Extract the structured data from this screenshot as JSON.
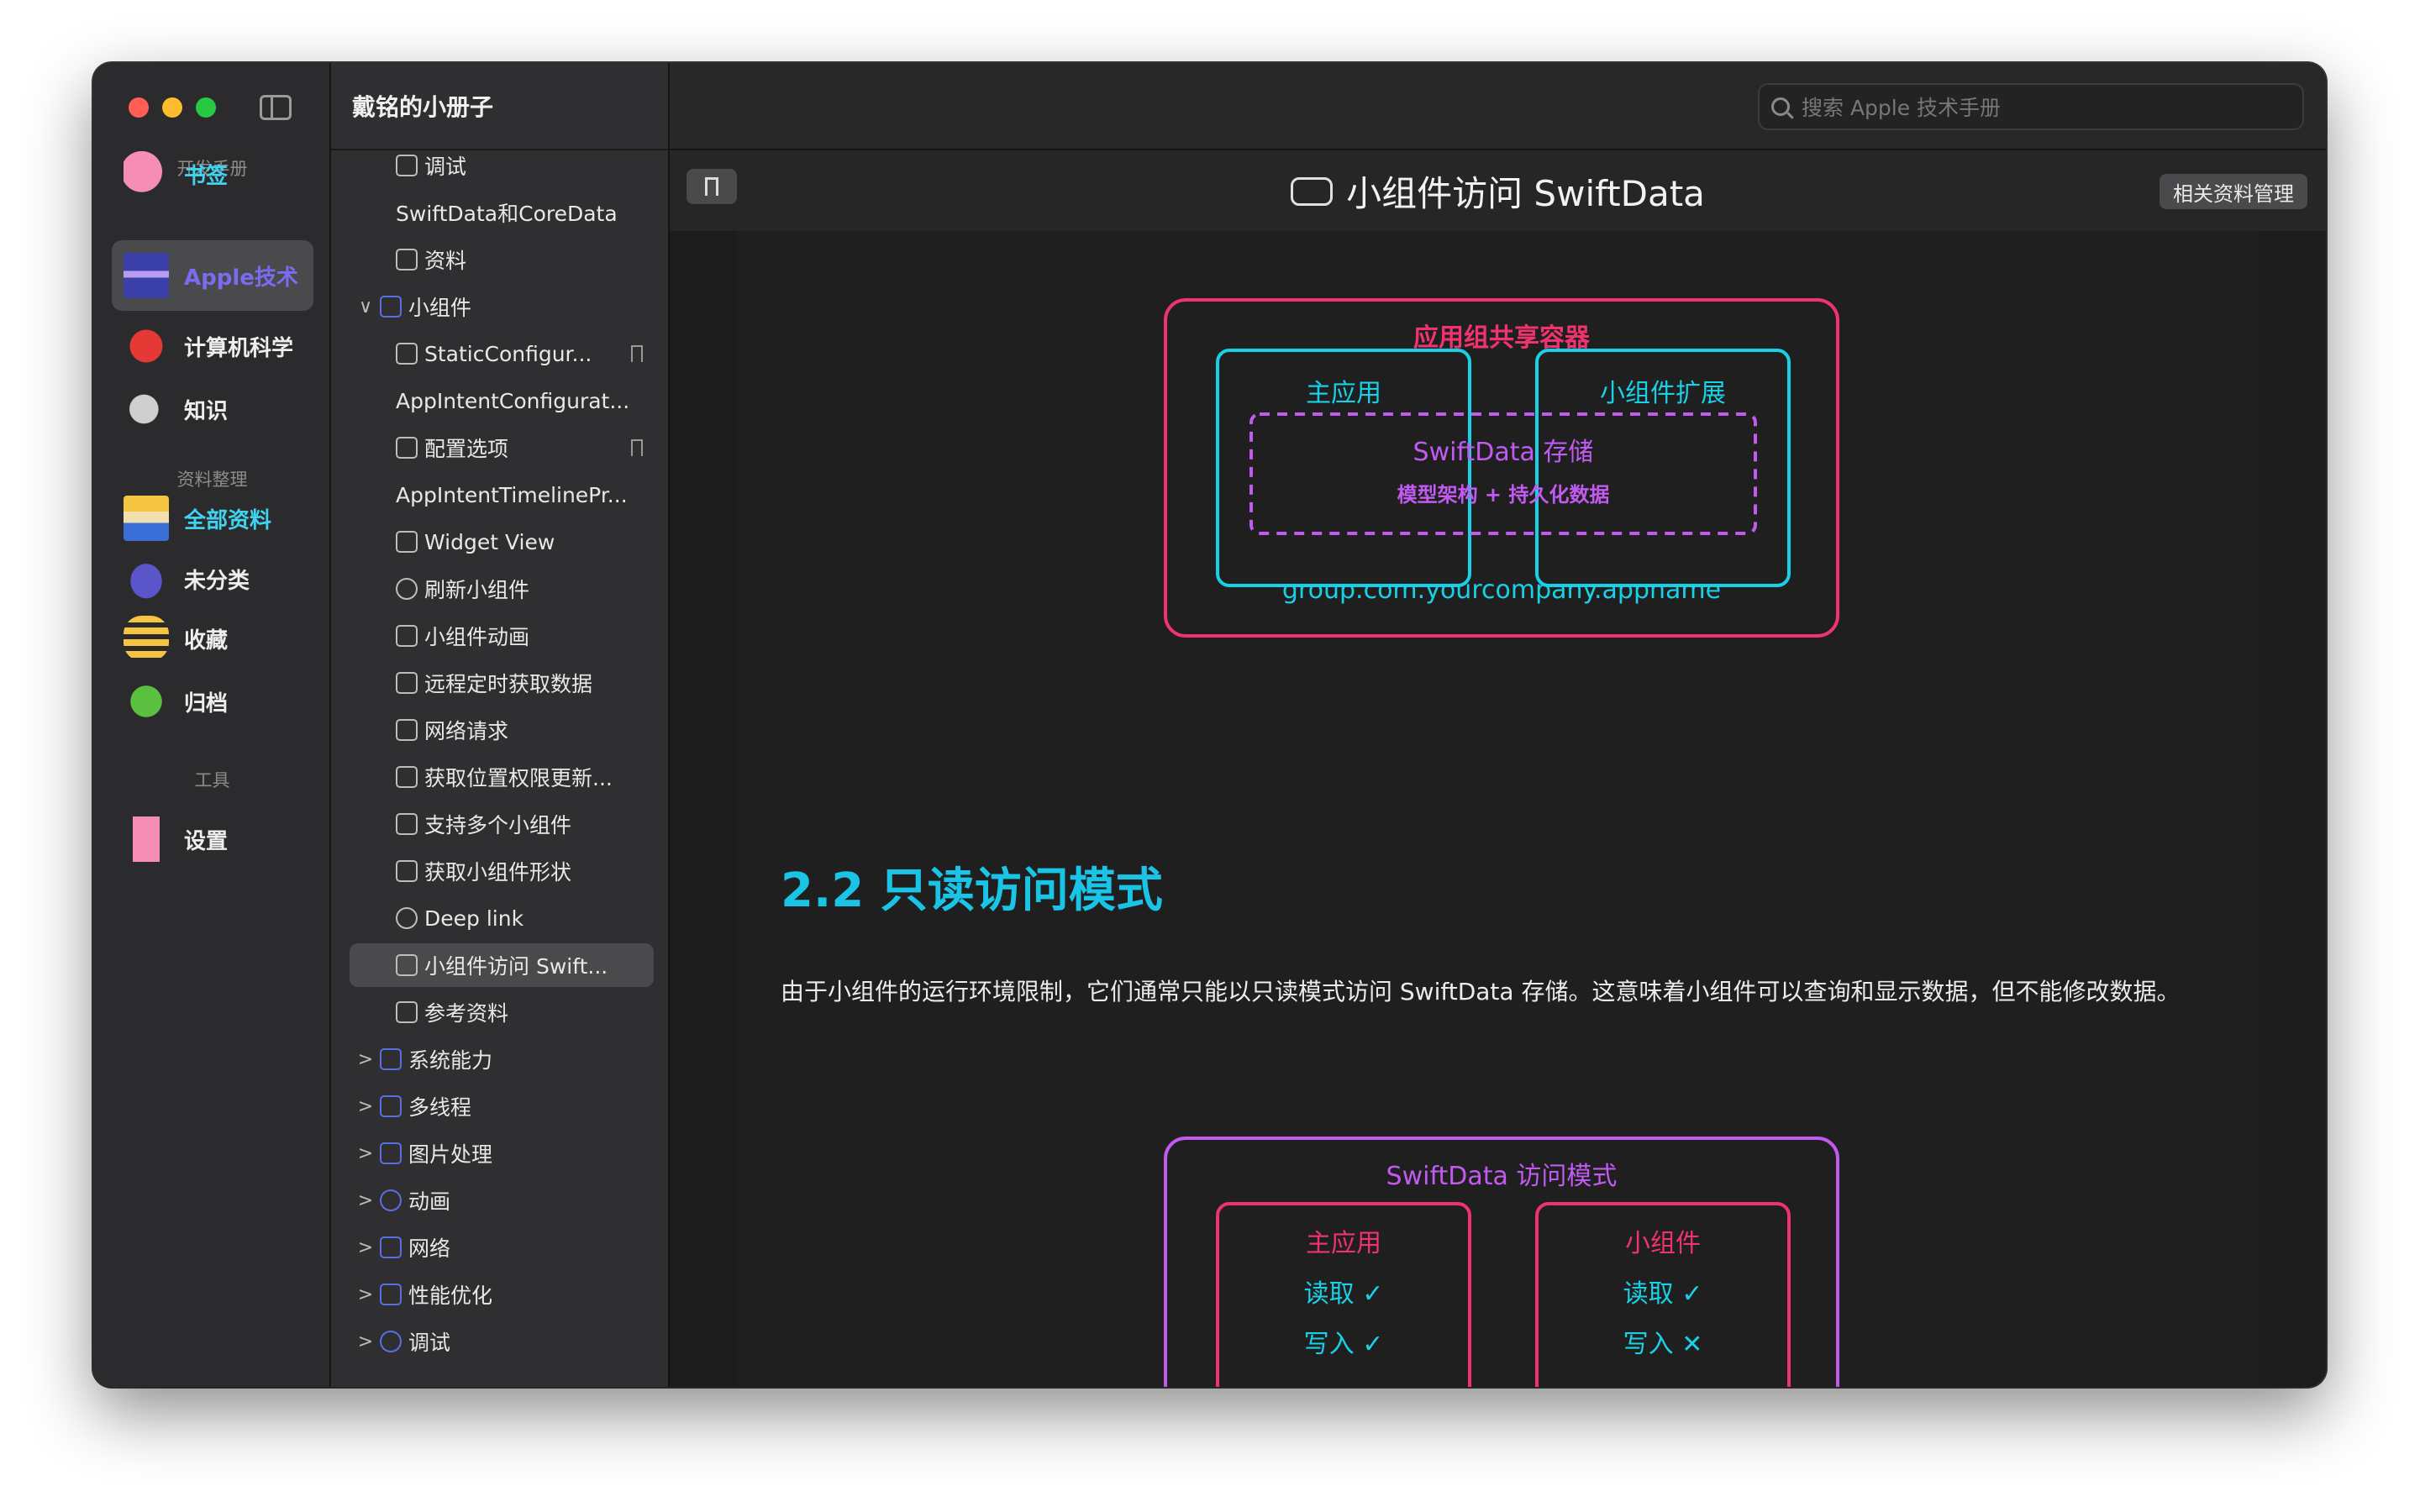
{
  "sidebar": {
    "sections": [
      "开发手册",
      "资料整理",
      "工具"
    ],
    "items": [
      {
        "label": "书签",
        "icon": "elephant-icon",
        "color": "cyan"
      },
      {
        "label": "Apple技术",
        "icon": "ninja-icon",
        "color": "active"
      },
      {
        "label": "计算机科学",
        "icon": "ladybug-icon"
      },
      {
        "label": "知识",
        "icon": "mouse-icon"
      },
      {
        "label": "全部资料",
        "icon": "king-icon",
        "color": "cyan"
      },
      {
        "label": "未分类",
        "icon": "invader-icon"
      },
      {
        "label": "收藏",
        "icon": "bee-icon"
      },
      {
        "label": "归档",
        "icon": "frog-icon"
      },
      {
        "label": "设置",
        "icon": "popsicle-icon"
      }
    ]
  },
  "tree": {
    "header": "戴铭的小册子",
    "rows": [
      {
        "label": "调试",
        "indent": 1,
        "icon": "bug-icon"
      },
      {
        "label": "SwiftData和CoreData",
        "indent": 1,
        "icon": ""
      },
      {
        "label": "资料",
        "indent": 1,
        "icon": "books-icon"
      },
      {
        "label": "小组件",
        "indent": 0,
        "icon": "widget-icon",
        "chev": "∨"
      },
      {
        "label": "StaticConfigur...",
        "indent": 1,
        "icon": "doc-icon",
        "bookmark": true
      },
      {
        "label": "AppIntentConfigurat...",
        "indent": 1,
        "icon": ""
      },
      {
        "label": "配置选项",
        "indent": 1,
        "icon": "phone-icon",
        "bookmark": true
      },
      {
        "label": "AppIntentTimelinePr...",
        "indent": 1,
        "icon": ""
      },
      {
        "label": "Widget View",
        "indent": 1,
        "icon": "stack-icon"
      },
      {
        "label": "刷新小组件",
        "indent": 1,
        "icon": "refresh-icon"
      },
      {
        "label": "小组件动画",
        "indent": 1,
        "icon": "runner-icon"
      },
      {
        "label": "远程定时获取数据",
        "indent": 1,
        "icon": "cloud-icon"
      },
      {
        "label": "网络请求",
        "indent": 1,
        "icon": "cloud-icon"
      },
      {
        "label": "获取位置权限更新...",
        "indent": 1,
        "icon": "location-icon"
      },
      {
        "label": "支持多个小组件",
        "indent": 1,
        "icon": "grid-icon"
      },
      {
        "label": "获取小组件形状",
        "indent": 1,
        "icon": "rect-icon"
      },
      {
        "label": "Deep link",
        "indent": 1,
        "icon": "link-icon"
      },
      {
        "label": "小组件访问 Swift...",
        "indent": 1,
        "icon": "disk-icon",
        "selected": true
      },
      {
        "label": "参考资料",
        "indent": 1,
        "icon": "books-icon"
      },
      {
        "label": "系统能力",
        "indent": 0,
        "icon": "screen-icon",
        "chev": ">"
      },
      {
        "label": "多线程",
        "indent": 0,
        "icon": "list-icon",
        "chev": ">"
      },
      {
        "label": "图片处理",
        "indent": 0,
        "icon": "photo-icon",
        "chev": ">"
      },
      {
        "label": "动画",
        "indent": 0,
        "icon": "circle-half-icon",
        "chev": ">"
      },
      {
        "label": "网络",
        "indent": 0,
        "icon": "network-icon",
        "chev": ">"
      },
      {
        "label": "性能优化",
        "indent": 0,
        "icon": "gauge-icon",
        "chev": ">"
      },
      {
        "label": "调试",
        "indent": 0,
        "icon": "debug-icon",
        "chev": ">"
      }
    ]
  },
  "search": {
    "placeholder": "搜索 Apple 技术手册"
  },
  "doc": {
    "title": "小组件访问 SwiftData",
    "ref_button": "相关资料管理",
    "heading": "2.2 只读访问模式",
    "paragraph": "由于小组件的运行环境限制，它们通常只能以只读模式访问 SwiftData 存储。这意味着小组件可以查询和显示数据，但不能修改数据。"
  },
  "diagram1": {
    "container_title": "应用组共享容器",
    "app": "主应用",
    "extension": "小组件扩展",
    "store_title": "SwiftData 存储",
    "store_sub": "模型架构 + 持久化数据",
    "group_id": "group.com.yourcompany.appname",
    "colors": {
      "pink": "#f0336e",
      "cyan": "#19d1e6",
      "purple": "#c15af0"
    }
  },
  "diagram2": {
    "title": "SwiftData 访问模式",
    "app": {
      "name": "主应用",
      "read": "读取 ✓",
      "write": "写入 ✓"
    },
    "widget": {
      "name": "小组件",
      "read": "读取 ✓",
      "write": "写入 ✕"
    }
  }
}
